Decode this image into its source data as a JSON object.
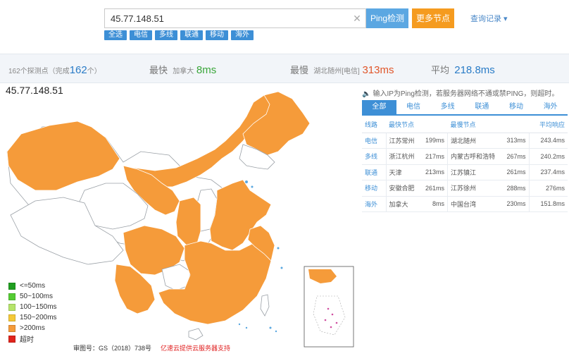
{
  "search": {
    "value": "45.77.148.51",
    "ping_label": "Ping检测",
    "more_label": "更多节点",
    "history_label": "查询记录 ▾",
    "clear": "✕"
  },
  "filters": [
    "全选",
    "电信",
    "多线",
    "联通",
    "移动",
    "海外"
  ],
  "summary": {
    "nodes_prefix": "162个探测点（完成",
    "nodes_done": "162",
    "nodes_suffix": "个）",
    "fastest_label": "最快",
    "fastest_loc": "加拿大",
    "fastest_val": "8ms",
    "slowest_label": "最慢",
    "slowest_loc": "湖北随州[电信]",
    "slowest_val": "313ms",
    "avg_label": "平均",
    "avg_val": "218.8ms"
  },
  "map": {
    "ip_title": "45.77.148.51"
  },
  "legend": [
    {
      "label": "<=50ms",
      "color": "#1f9e1f"
    },
    {
      "label": "50~100ms",
      "color": "#55cc33"
    },
    {
      "label": "100~150ms",
      "color": "#b6e46a"
    },
    {
      "label": "150~200ms",
      "color": "#f5c938"
    },
    {
      "label": ">200ms",
      "color": "#f59b3a"
    },
    {
      "label": "超时",
      "color": "#e0241c"
    }
  ],
  "footer": {
    "note": "审图号：GS（2018）738号",
    "sponsor": "亿速云提供云服务器支持"
  },
  "hint": "输入IP为Ping检测，若服务器网络不通或禁PING，则超时。",
  "tabs": [
    "全部",
    "电信",
    "多线",
    "联通",
    "移动",
    "海外"
  ],
  "table": {
    "headers": [
      "线路",
      "最快节点",
      "",
      "最慢节点",
      "",
      "平均响应"
    ],
    "rows": [
      [
        "电信",
        "江苏常州",
        "199ms",
        "湖北随州",
        "313ms",
        "243.4ms"
      ],
      [
        "多线",
        "浙江杭州",
        "217ms",
        "内蒙古呼和浩特",
        "267ms",
        "240.2ms"
      ],
      [
        "联通",
        "天津",
        "213ms",
        "江苏镇江",
        "261ms",
        "237.4ms"
      ],
      [
        "移动",
        "安徽合肥",
        "261ms",
        "江苏徐州",
        "288ms",
        "276ms"
      ],
      [
        "海外",
        "加拿大",
        "8ms",
        "中国台湾",
        "230ms",
        "151.8ms"
      ]
    ]
  }
}
